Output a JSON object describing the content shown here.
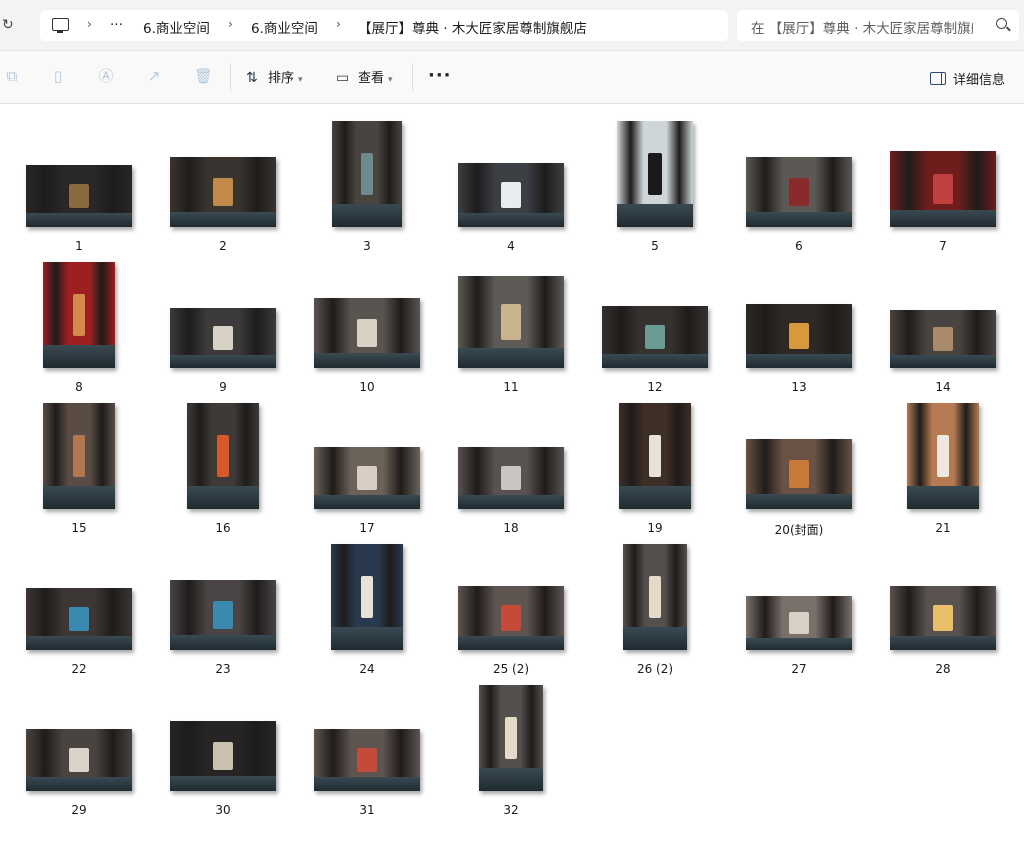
{
  "address": {
    "crumbs": [
      "6.商业空间",
      "6.商业空间",
      "【展厅】尊典 · 木大匠家居尊制旗舰店"
    ],
    "ellipsis": "···",
    "search_placeholder": "在 【展厅】尊典 · 木大匠家居尊制旗舰店 中搜索"
  },
  "toolbar": {
    "sort_label": "排序",
    "view_label": "查看",
    "more_label": "···",
    "details_label": "详细信息"
  },
  "files": [
    {
      "name": "1",
      "fill": "#2a2826",
      "accent": "#8a6a3f"
    },
    {
      "name": "2",
      "fill": "#3a3430",
      "accent": "#c28a4a"
    },
    {
      "name": "3",
      "fill": "#4a4440",
      "accent": "#6f8a8c"
    },
    {
      "name": "4",
      "fill": "#3b3f44",
      "accent": "#e8ecef"
    },
    {
      "name": "5",
      "fill": "#cfd6da",
      "accent": "#1a1a1a"
    },
    {
      "name": "6",
      "fill": "#5c5854",
      "accent": "#8a2a2a"
    },
    {
      "name": "7",
      "fill": "#6e1c1c",
      "accent": "#c04040"
    },
    {
      "name": "8",
      "fill": "#9e1f1f",
      "accent": "#d48a4a"
    },
    {
      "name": "9",
      "fill": "#3c3a3a",
      "accent": "#d8d2c6"
    },
    {
      "name": "10",
      "fill": "#5a5450",
      "accent": "#d8d2c6"
    },
    {
      "name": "11",
      "fill": "#5e5a56",
      "accent": "#c9b48e"
    },
    {
      "name": "12",
      "fill": "#35312f",
      "accent": "#6b9a94"
    },
    {
      "name": "13",
      "fill": "#2e2925",
      "accent": "#d89a3a"
    },
    {
      "name": "14",
      "fill": "#4a4440",
      "accent": "#a98a6a"
    },
    {
      "name": "15",
      "fill": "#5a4c44",
      "accent": "#b07850"
    },
    {
      "name": "16",
      "fill": "#3e3a38",
      "accent": "#d85a2a"
    },
    {
      "name": "17",
      "fill": "#6b625a",
      "accent": "#d8cfc2"
    },
    {
      "name": "18",
      "fill": "#585250",
      "accent": "#c8c6c2"
    },
    {
      "name": "19",
      "fill": "#3e2e26",
      "accent": "#e8e2da"
    },
    {
      "name": "20(封面)",
      "fill": "#6a5246",
      "accent": "#c87a3a"
    },
    {
      "name": "21",
      "fill": "#b57a52",
      "accent": "#efe8e0"
    },
    {
      "name": "22",
      "fill": "#3c3634",
      "accent": "#3a8ab0"
    },
    {
      "name": "23",
      "fill": "#4a4544",
      "accent": "#3a8ab0"
    },
    {
      "name": "24",
      "fill": "#2a3a4e",
      "accent": "#e8e2d8"
    },
    {
      "name": "25 (2)",
      "fill": "#5e5450",
      "accent": "#c44a3a"
    },
    {
      "name": "26 (2)",
      "fill": "#54504e",
      "accent": "#e8d8c8"
    },
    {
      "name": "27",
      "fill": "#7a706a",
      "accent": "#d8d0c6"
    },
    {
      "name": "28",
      "fill": "#5a524e",
      "accent": "#e8c06a"
    },
    {
      "name": "29",
      "fill": "#4a4440",
      "accent": "#d8d2c8"
    },
    {
      "name": "30",
      "fill": "#262424",
      "accent": "#c9c0b0"
    },
    {
      "name": "31",
      "fill": "#5e5450",
      "accent": "#c44a3a"
    },
    {
      "name": "32",
      "fill": "#54504e",
      "accent": "#e8d8c8"
    }
  ]
}
